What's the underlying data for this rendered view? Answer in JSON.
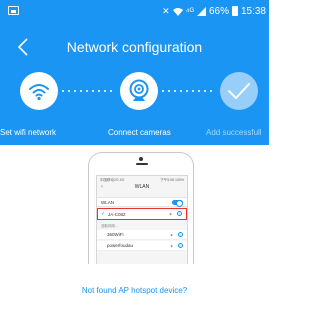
{
  "status_bar": {
    "network_text": "⁴ᴳ",
    "battery_percent": "66%",
    "time": "15:38"
  },
  "navbar": {
    "title": "Network configuration"
  },
  "steps": [
    {
      "label": "Set wifi network",
      "state": "active",
      "icon": "wifi-icon"
    },
    {
      "label": "Connect cameras",
      "state": "active",
      "icon": "camera-icon"
    },
    {
      "label": "Add successfull",
      "state": "inactive",
      "icon": "check-icon"
    }
  ],
  "illustration": {
    "status_left": "中国移动2G 4G",
    "status_right": "下午5:08 100%",
    "nav_title": "WLAN",
    "wlan_label": "WLAN",
    "selected_network": "JA-C082",
    "choose_label": "选取网络…",
    "networks": [
      "360WiFi",
      "powerfoudau"
    ]
  },
  "not_found_link": "Not found AP hotspot device?",
  "colors": {
    "header_bg": "#1b95f3",
    "accent": "#1b95f3",
    "inactive_label": "#a9d7fb"
  }
}
